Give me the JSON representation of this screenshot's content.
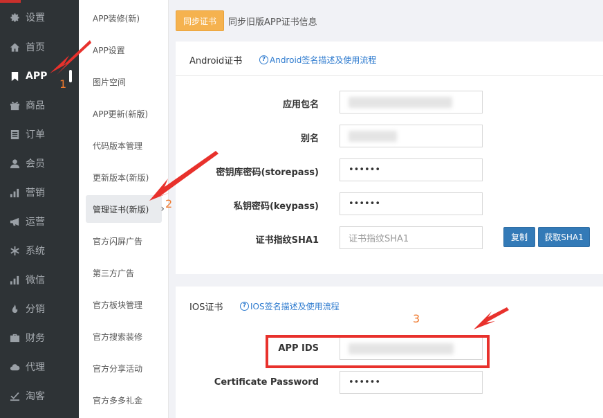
{
  "nav": {
    "items": [
      {
        "label": "设置",
        "icon": "gear-icon"
      },
      {
        "label": "首页",
        "icon": "home-icon"
      },
      {
        "label": "APP",
        "icon": "bookmark-icon",
        "active": true
      },
      {
        "label": "商品",
        "icon": "gift-icon"
      },
      {
        "label": "订单",
        "icon": "list-icon"
      },
      {
        "label": "会员",
        "icon": "user-icon"
      },
      {
        "label": "营销",
        "icon": "bar-chart-icon"
      },
      {
        "label": "运营",
        "icon": "megaphone-icon"
      },
      {
        "label": "系统",
        "icon": "asterisk-icon"
      },
      {
        "label": "微信",
        "icon": "bar-chart-icon"
      },
      {
        "label": "分销",
        "icon": "fire-icon"
      },
      {
        "label": "财务",
        "icon": "briefcase-icon"
      },
      {
        "label": "代理",
        "icon": "cloud-icon"
      },
      {
        "label": "淘客",
        "icon": "checkbox-icon"
      }
    ]
  },
  "submenu": {
    "items": [
      {
        "label": "APP装修(新)"
      },
      {
        "label": "APP设置"
      },
      {
        "label": "图片空间"
      },
      {
        "label": "APP更新(新版)"
      },
      {
        "label": "代码版本管理"
      },
      {
        "label": "更新版本(新版)"
      },
      {
        "label": "管理证书(新版)",
        "active": true
      },
      {
        "label": "官方闪屏广告"
      },
      {
        "label": "第三方广告"
      },
      {
        "label": "官方板块管理"
      },
      {
        "label": "官方搜索装修"
      },
      {
        "label": "官方分享活动"
      },
      {
        "label": "官方多多礼金"
      }
    ],
    "chevron": "›"
  },
  "toolbar": {
    "sync_label": "同步证书",
    "sync_text": "同步旧版APP证书信息"
  },
  "android": {
    "title": "Android证书",
    "help": "Android签名描述及使用流程",
    "package_label": "应用包名",
    "alias_label": "别名",
    "storepass_label": "密钥库密码(storepass)",
    "storepass_value": "••••••",
    "keypass_label": "私钥密码(keypass)",
    "keypass_value": "••••••",
    "sha1_label": "证书指纹SHA1",
    "sha1_placeholder": "证书指纹SHA1",
    "copy_label": "复制",
    "get_sha1_label": "获取SHA1"
  },
  "ios": {
    "title": "IOS证书",
    "help": "IOS签名描述及使用流程",
    "app_ids_label": "APP IDS",
    "cert_password_label": "Certificate Password",
    "cert_password_value": "••••••"
  },
  "annotations": {
    "step1": "1",
    "step2": "2",
    "step3": "3",
    "color": "#e8312c"
  },
  "help_icon": "?"
}
